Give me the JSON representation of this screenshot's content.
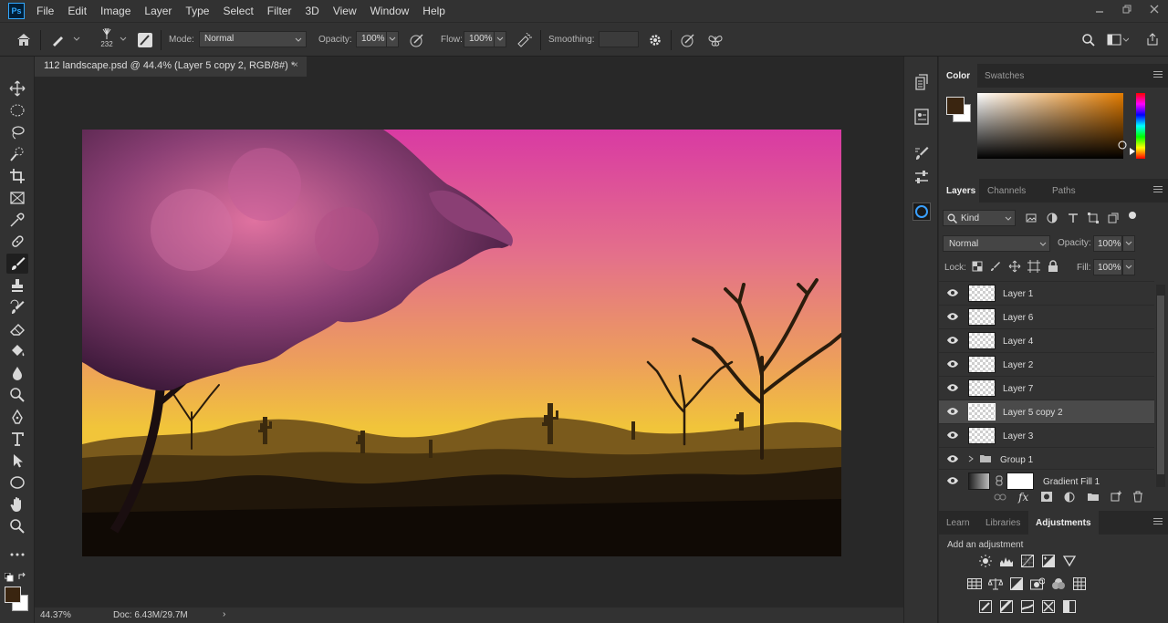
{
  "app": {
    "logo_text": "Ps"
  },
  "menu": [
    "File",
    "Edit",
    "Image",
    "Layer",
    "Type",
    "Select",
    "Filter",
    "3D",
    "View",
    "Window",
    "Help"
  ],
  "options": {
    "brush_size": "232",
    "mode_label": "Mode:",
    "mode_value": "Normal",
    "opacity_label": "Opacity:",
    "opacity_value": "100%",
    "flow_label": "Flow:",
    "flow_value": "100%",
    "smoothing_label": "Smoothing:",
    "smoothing_value": ""
  },
  "document": {
    "tab_title": "112 landscape.psd @ 44.4% (Layer 5 copy 2, RGB/8#) *",
    "close_glyph": "×"
  },
  "status": {
    "zoom": "44.37%",
    "doc_info": "Doc: 6.43M/29.7M",
    "arrow": "›"
  },
  "color_panel": {
    "tabs": [
      "Color",
      "Swatches"
    ],
    "foreground": "#3a2510",
    "background": "#ffffff"
  },
  "layers_panel": {
    "tabs": [
      "Layers",
      "Channels",
      "Paths"
    ],
    "filter_kind": "Kind",
    "blend_mode": "Normal",
    "opacity_label": "Opacity:",
    "opacity_value": "100%",
    "lock_label": "Lock:",
    "fill_label": "Fill:",
    "fill_value": "100%",
    "layers": [
      {
        "name": "Layer 1",
        "selected": false
      },
      {
        "name": "Layer 6",
        "selected": false
      },
      {
        "name": "Layer 4",
        "selected": false
      },
      {
        "name": "Layer 2",
        "selected": false
      },
      {
        "name": "Layer 7",
        "selected": false
      },
      {
        "name": "Layer 5 copy 2",
        "selected": true
      },
      {
        "name": "Layer 3",
        "selected": false
      },
      {
        "name": "Group 1",
        "selected": false
      },
      {
        "name": "Gradient Fill 1",
        "selected": false
      }
    ]
  },
  "adjust_panel": {
    "tabs": [
      "Learn",
      "Libraries",
      "Adjustments"
    ],
    "heading": "Add an adjustment"
  }
}
